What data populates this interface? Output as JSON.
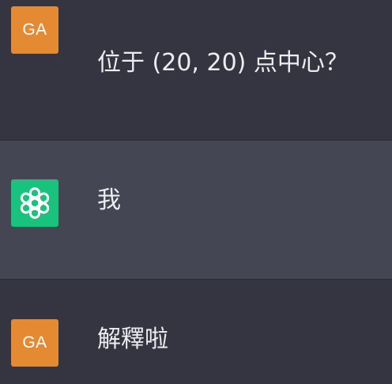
{
  "messages": [
    {
      "role": "user",
      "avatar_initials": "GA",
      "text": "位于 (20, 20) 点中心？"
    },
    {
      "role": "assistant",
      "avatar_icon": "openai-logo-icon",
      "text": "我"
    },
    {
      "role": "user",
      "avatar_initials": "GA",
      "text": "解釋啦"
    }
  ],
  "colors": {
    "page_bg": "#343541",
    "assistant_bg": "#444654",
    "user_avatar_bg": "#e48a33",
    "assistant_avatar_bg": "#19c37d",
    "text": "#ececf1"
  }
}
